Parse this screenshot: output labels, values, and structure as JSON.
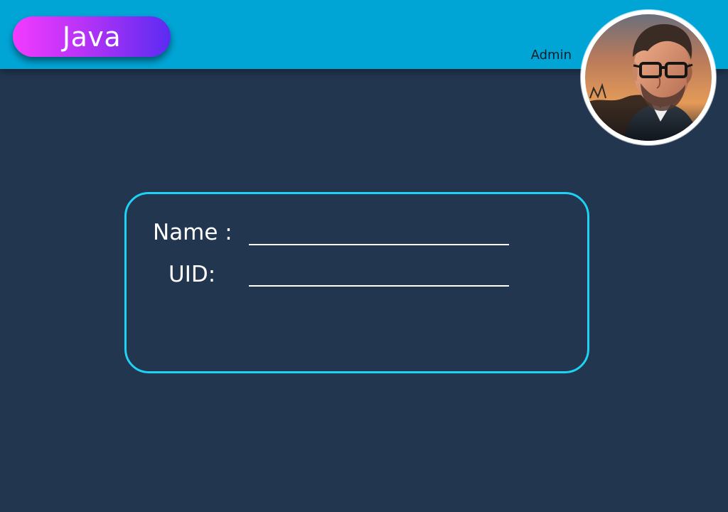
{
  "header": {
    "app_badge_label": "Java",
    "user_role": "Admin",
    "avatar_name": "avatar"
  },
  "form": {
    "name_label": "Name :",
    "uid_label": "UID:",
    "name_value": "",
    "uid_value": ""
  },
  "theme": {
    "page_background": "#22364f",
    "header_background": "#00a5d6",
    "card_border": "#1fd1f2",
    "badge_gradient_start": "#f23bff",
    "badge_gradient_end": "#5b2bf2"
  }
}
